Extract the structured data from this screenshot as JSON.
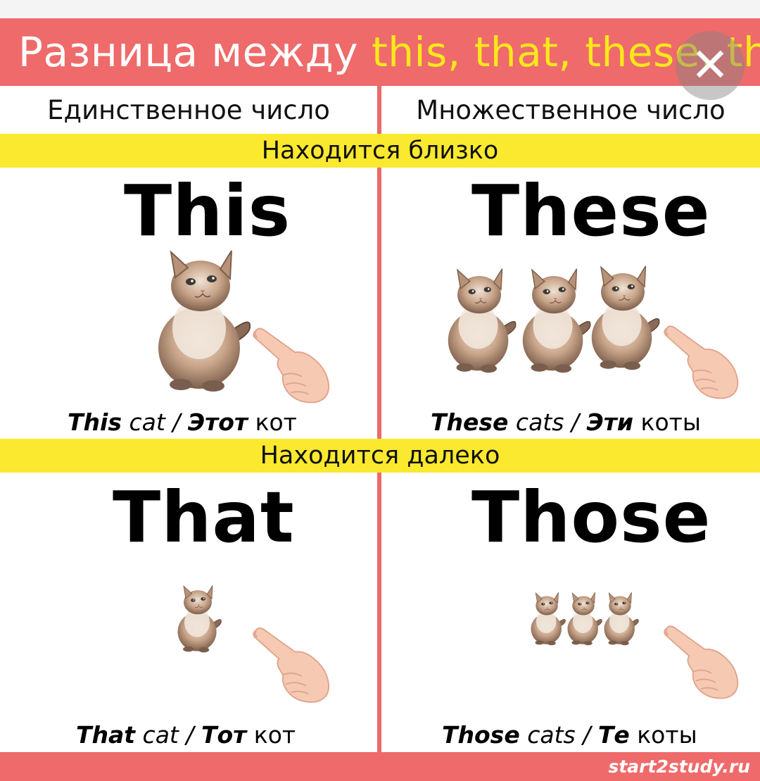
{
  "header": {
    "title_prefix": "Разница между",
    "title_highlight": "this, that, these, those",
    "close_symbol": "✕"
  },
  "columns": {
    "singular": "Единственное число",
    "plural": "Множественное число"
  },
  "bands": {
    "near": "Находится близко",
    "far": "Находится далеко"
  },
  "cells": {
    "this": {
      "word": "This",
      "caption_en_bold": "This",
      "caption_en_rest": "cat",
      "separator": "/",
      "caption_ru_bold": "Этот",
      "caption_ru_rest": "кот"
    },
    "these": {
      "word": "These",
      "caption_en_bold": "These",
      "caption_en_rest": "cats",
      "separator": "/",
      "caption_ru_bold": "Эти",
      "caption_ru_rest": "коты"
    },
    "that": {
      "word": "That",
      "caption_en_bold": "That",
      "caption_en_rest": "cat",
      "separator": "/",
      "caption_ru_bold": "Тот",
      "caption_ru_rest": "кот"
    },
    "those": {
      "word": "Those",
      "caption_en_bold": "Those",
      "caption_en_rest": "cats",
      "separator": "/",
      "caption_ru_bold": "Те",
      "caption_ru_rest": "коты"
    }
  },
  "icons": {
    "cat": "cat-icon",
    "hand": "pointing-hand-icon",
    "close": "close-icon"
  },
  "colors": {
    "header_bg": "#ef6a6a",
    "highlight_text": "#f8e81c",
    "band_bg": "#fbe92f",
    "divider": "#e96c6c",
    "cat_fur": "#c9a58a",
    "hand_skin": "#f6c9b3"
  },
  "footer": {
    "site": "start2study.ru"
  }
}
